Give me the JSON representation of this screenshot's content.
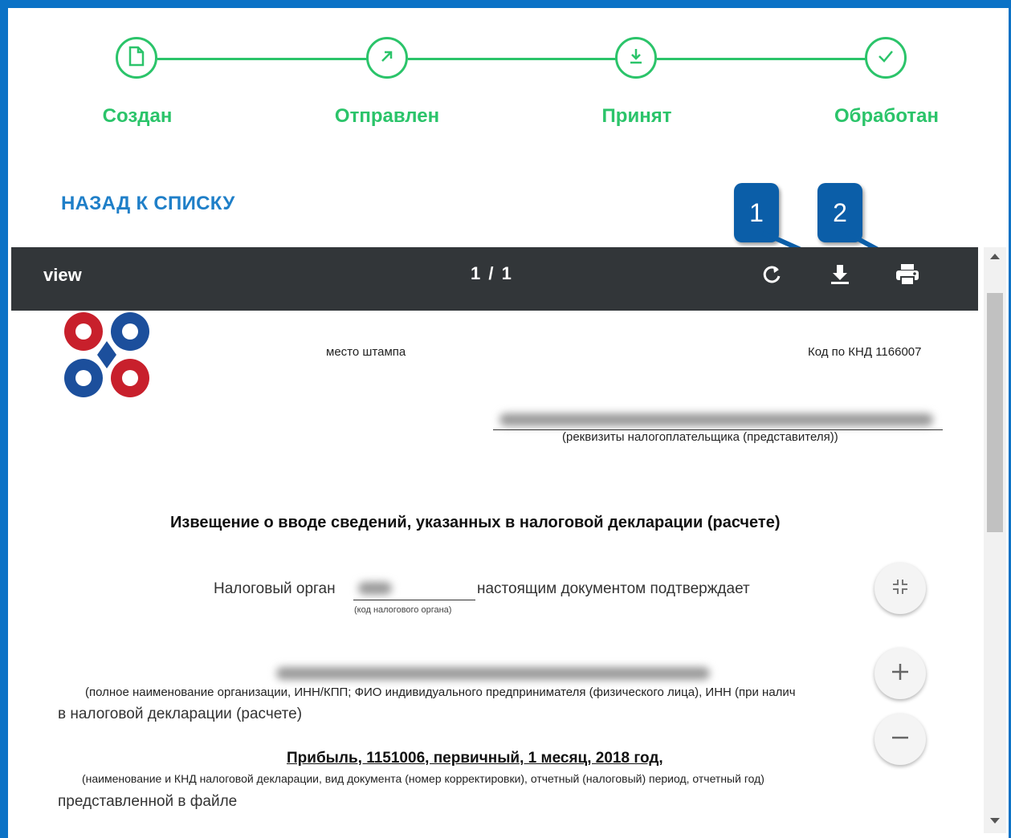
{
  "stepper": {
    "steps": [
      {
        "label": "Создан",
        "icon": "document-icon"
      },
      {
        "label": "Отправлен",
        "icon": "arrow-up-right-icon"
      },
      {
        "label": "Принят",
        "icon": "download-icon"
      },
      {
        "label": "Обработан",
        "icon": "check-icon"
      }
    ],
    "color": "#2bc46a"
  },
  "nav": {
    "back_label": "НАЗАД К СПИСКУ"
  },
  "callouts": [
    "1",
    "2"
  ],
  "viewer": {
    "title": "view",
    "pages": "1 / 1",
    "tools": [
      "rotate-icon",
      "download-icon",
      "print-icon"
    ]
  },
  "document": {
    "stamp_place": "место штампа",
    "knd_code": "Код по КНД 1166007",
    "requisites_caption": "(реквизиты налогоплательщика (представителя))",
    "heading": "Извещение о вводе сведений, указанных в налоговой декларации (расчете)",
    "tax_org_prefix": "Налоговый орган",
    "tax_org_suffix": "настоящим документом подтверждает",
    "tax_org_caption": "(код налогового органа)",
    "org_caption": "(полное наименование организации, ИНН/КПП; ФИО индивидуального предпринимателя (физического лица), ИНН (при налич",
    "in_declaration": "в налоговой декларации (расчете)",
    "declaration_value": "Прибыль, 1151006, первичный, 1 месяц, 2018 год,",
    "declaration_caption": "(наименование и КНД налоговой декларации, вид документа (номер корректировки), отчетный (налоговый) период, отчетный год)",
    "submitted_in_file": "представленной в файле"
  },
  "colors": {
    "accent": "#0b72c6",
    "link": "#1f7fc8",
    "toolbar": "#323639"
  }
}
